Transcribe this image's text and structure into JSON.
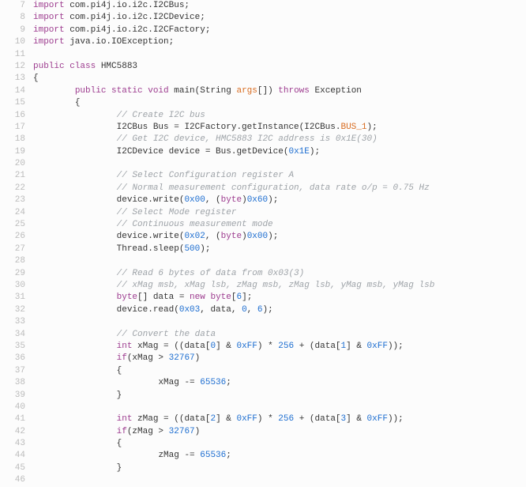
{
  "lines": [
    {
      "n": 7,
      "indent": 0,
      "tokens": [
        [
          "kw",
          "import"
        ],
        [
          "",
          " com.pi4j.io.i2c.I2CBus;"
        ]
      ]
    },
    {
      "n": 8,
      "indent": 0,
      "tokens": [
        [
          "kw",
          "import"
        ],
        [
          "",
          " com.pi4j.io.i2c.I2CDevice;"
        ]
      ]
    },
    {
      "n": 9,
      "indent": 0,
      "tokens": [
        [
          "kw",
          "import"
        ],
        [
          "",
          " com.pi4j.io.i2c.I2CFactory;"
        ]
      ]
    },
    {
      "n": 10,
      "indent": 0,
      "tokens": [
        [
          "kw",
          "import"
        ],
        [
          "",
          " java.io.IOException;"
        ]
      ]
    },
    {
      "n": 11,
      "indent": 0,
      "tokens": []
    },
    {
      "n": 12,
      "indent": 0,
      "tokens": [
        [
          "kw",
          "public class"
        ],
        [
          "",
          " HMC5883"
        ]
      ]
    },
    {
      "n": 13,
      "indent": 0,
      "tokens": [
        [
          "",
          "{"
        ]
      ]
    },
    {
      "n": 14,
      "indent": 2,
      "tokens": [
        [
          "kw",
          "public static void"
        ],
        [
          "",
          " main(String "
        ],
        [
          "param",
          "args"
        ],
        [
          "",
          "[]) "
        ],
        [
          "kw",
          "throws"
        ],
        [
          "",
          " Exception"
        ]
      ]
    },
    {
      "n": 15,
      "indent": 2,
      "tokens": [
        [
          "",
          "{"
        ]
      ]
    },
    {
      "n": 16,
      "indent": 4,
      "tokens": [
        [
          "com",
          "// Create I2C bus"
        ]
      ]
    },
    {
      "n": 17,
      "indent": 4,
      "tokens": [
        [
          "",
          "I2CBus Bus = I2CFactory.getInstance(I2CBus."
        ],
        [
          "ident",
          "BUS_1"
        ],
        [
          "",
          ");"
        ]
      ]
    },
    {
      "n": 18,
      "indent": 4,
      "tokens": [
        [
          "com",
          "// Get I2C device, HMC5883 I2C address is 0x1E(30)"
        ]
      ]
    },
    {
      "n": 19,
      "indent": 4,
      "tokens": [
        [
          "",
          "I2CDevice device = Bus.getDevice("
        ],
        [
          "num",
          "0x1E"
        ],
        [
          "",
          ");"
        ]
      ]
    },
    {
      "n": 20,
      "indent": 0,
      "tokens": []
    },
    {
      "n": 21,
      "indent": 4,
      "tokens": [
        [
          "com",
          "// Select Configuration register A"
        ]
      ]
    },
    {
      "n": 22,
      "indent": 4,
      "tokens": [
        [
          "com",
          "// Normal measurement configuration, data rate o/p = 0.75 Hz"
        ]
      ]
    },
    {
      "n": 23,
      "indent": 4,
      "tokens": [
        [
          "",
          "device.write("
        ],
        [
          "num",
          "0x00"
        ],
        [
          "",
          ", ("
        ],
        [
          "kw",
          "byte"
        ],
        [
          "",
          ")"
        ],
        [
          "num",
          "0x60"
        ],
        [
          "",
          ");"
        ]
      ]
    },
    {
      "n": 24,
      "indent": 4,
      "tokens": [
        [
          "com",
          "// Select Mode register"
        ]
      ]
    },
    {
      "n": 25,
      "indent": 4,
      "tokens": [
        [
          "com",
          "// Continuous measurement mode"
        ]
      ]
    },
    {
      "n": 26,
      "indent": 4,
      "tokens": [
        [
          "",
          "device.write("
        ],
        [
          "num",
          "0x02"
        ],
        [
          "",
          ", ("
        ],
        [
          "kw",
          "byte"
        ],
        [
          "",
          ")"
        ],
        [
          "num",
          "0x00"
        ],
        [
          "",
          ");"
        ]
      ]
    },
    {
      "n": 27,
      "indent": 4,
      "tokens": [
        [
          "",
          "Thread.sleep("
        ],
        [
          "num",
          "500"
        ],
        [
          "",
          ");"
        ]
      ]
    },
    {
      "n": 28,
      "indent": 0,
      "tokens": []
    },
    {
      "n": 29,
      "indent": 4,
      "tokens": [
        [
          "com",
          "// Read 6 bytes of data from 0x03(3)"
        ]
      ]
    },
    {
      "n": 30,
      "indent": 4,
      "tokens": [
        [
          "com",
          "// xMag msb, xMag lsb, zMag msb, zMag lsb, yMag msb, yMag lsb"
        ]
      ]
    },
    {
      "n": 31,
      "indent": 4,
      "tokens": [
        [
          "kw",
          "byte"
        ],
        [
          "",
          "[] data = "
        ],
        [
          "kw",
          "new"
        ],
        [
          "",
          " "
        ],
        [
          "kw",
          "byte"
        ],
        [
          "",
          "["
        ],
        [
          "num",
          "6"
        ],
        [
          "",
          "];"
        ]
      ]
    },
    {
      "n": 32,
      "indent": 4,
      "tokens": [
        [
          "",
          "device.read("
        ],
        [
          "num",
          "0x03"
        ],
        [
          "",
          ", data, "
        ],
        [
          "num",
          "0"
        ],
        [
          "",
          ", "
        ],
        [
          "num",
          "6"
        ],
        [
          "",
          ");"
        ]
      ]
    },
    {
      "n": 33,
      "indent": 0,
      "tokens": []
    },
    {
      "n": 34,
      "indent": 4,
      "tokens": [
        [
          "com",
          "// Convert the data"
        ]
      ]
    },
    {
      "n": 35,
      "indent": 4,
      "tokens": [
        [
          "kw",
          "int"
        ],
        [
          "",
          " xMag = ((data["
        ],
        [
          "num",
          "0"
        ],
        [
          "",
          "] & "
        ],
        [
          "num",
          "0xFF"
        ],
        [
          "",
          ") * "
        ],
        [
          "num",
          "256"
        ],
        [
          "",
          " + (data["
        ],
        [
          "num",
          "1"
        ],
        [
          "",
          "] & "
        ],
        [
          "num",
          "0xFF"
        ],
        [
          "",
          "));"
        ]
      ]
    },
    {
      "n": 36,
      "indent": 4,
      "tokens": [
        [
          "kw",
          "if"
        ],
        [
          "",
          "(xMag > "
        ],
        [
          "num",
          "32767"
        ],
        [
          "",
          ")"
        ]
      ]
    },
    {
      "n": 37,
      "indent": 4,
      "tokens": [
        [
          "",
          "{"
        ]
      ]
    },
    {
      "n": 38,
      "indent": 6,
      "tokens": [
        [
          "",
          "xMag -= "
        ],
        [
          "num",
          "65536"
        ],
        [
          "",
          ";"
        ]
      ]
    },
    {
      "n": 39,
      "indent": 4,
      "tokens": [
        [
          "",
          "}"
        ]
      ]
    },
    {
      "n": 40,
      "indent": 0,
      "tokens": []
    },
    {
      "n": 41,
      "indent": 4,
      "tokens": [
        [
          "kw",
          "int"
        ],
        [
          "",
          " zMag = ((data["
        ],
        [
          "num",
          "2"
        ],
        [
          "",
          "] & "
        ],
        [
          "num",
          "0xFF"
        ],
        [
          "",
          ") * "
        ],
        [
          "num",
          "256"
        ],
        [
          "",
          " + (data["
        ],
        [
          "num",
          "3"
        ],
        [
          "",
          "] & "
        ],
        [
          "num",
          "0xFF"
        ],
        [
          "",
          "));"
        ]
      ]
    },
    {
      "n": 42,
      "indent": 4,
      "tokens": [
        [
          "kw",
          "if"
        ],
        [
          "",
          "(zMag > "
        ],
        [
          "num",
          "32767"
        ],
        [
          "",
          ")"
        ]
      ]
    },
    {
      "n": 43,
      "indent": 4,
      "tokens": [
        [
          "",
          "{"
        ]
      ]
    },
    {
      "n": 44,
      "indent": 6,
      "tokens": [
        [
          "",
          "zMag -= "
        ],
        [
          "num",
          "65536"
        ],
        [
          "",
          ";"
        ]
      ]
    },
    {
      "n": 45,
      "indent": 4,
      "tokens": [
        [
          "",
          "}"
        ]
      ]
    },
    {
      "n": 46,
      "indent": 0,
      "tokens": []
    }
  ]
}
